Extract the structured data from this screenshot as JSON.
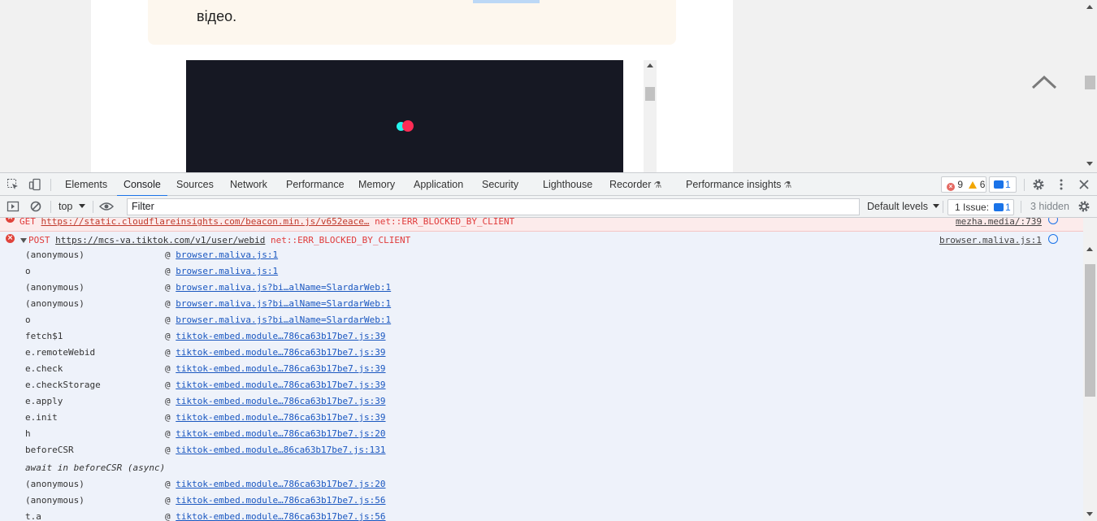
{
  "page": {
    "note_text": "відео.",
    "scroll_to_top_icon": "chevron-up-icon"
  },
  "devtools": {
    "tabs": [
      "Elements",
      "Console",
      "Sources",
      "Network",
      "Performance",
      "Memory",
      "Application",
      "Security",
      "Lighthouse",
      "Recorder",
      "Performance insights"
    ],
    "active_tab": "Console",
    "error_count": "9",
    "warning_count": "6",
    "message_count": "1",
    "toolbar": {
      "context": "top",
      "filter_placeholder": "Filter",
      "levels": "Default levels",
      "issues_label": "1 Issue:",
      "issues_count": "1",
      "hidden": "3 hidden"
    },
    "colors": {
      "accent": "#1a73e8",
      "error": "#e03a3a",
      "error_row_bg": "#fcebeb",
      "selected_row_bg": "#eef2fa"
    }
  },
  "console": {
    "get_row": {
      "method": "GET",
      "url": "https://static.cloudflareinsights.com/beacon.min.js/v652eace…",
      "error": "net::ERR_BLOCKED_BY_CLIENT",
      "source": "mezha.media/:739"
    },
    "post_row": {
      "method": "POST",
      "url": "https://mcs-va.tiktok.com/v1/user/webid",
      "error": "net::ERR_BLOCKED_BY_CLIENT",
      "source": "browser.maliva.js:1"
    },
    "stack": [
      {
        "fn": "(anonymous)",
        "link": "browser.maliva.js:1"
      },
      {
        "fn": "o",
        "link": "browser.maliva.js:1"
      },
      {
        "fn": "(anonymous)",
        "link": "browser.maliva.js?bi…alName=SlardarWeb:1"
      },
      {
        "fn": "(anonymous)",
        "link": "browser.maliva.js?bi…alName=SlardarWeb:1"
      },
      {
        "fn": "o",
        "link": "browser.maliva.js?bi…alName=SlardarWeb:1"
      },
      {
        "fn": "fetch$1",
        "link": "tiktok-embed.module…786ca63b17be7.js:39"
      },
      {
        "fn": "e.remoteWebid",
        "link": "tiktok-embed.module…786ca63b17be7.js:39"
      },
      {
        "fn": "e.check",
        "link": "tiktok-embed.module…786ca63b17be7.js:39"
      },
      {
        "fn": "e.checkStorage",
        "link": "tiktok-embed.module…786ca63b17be7.js:39"
      },
      {
        "fn": "e.apply",
        "link": "tiktok-embed.module…786ca63b17be7.js:39"
      },
      {
        "fn": "e.init",
        "link": "tiktok-embed.module…786ca63b17be7.js:39"
      },
      {
        "fn": "h",
        "link": "tiktok-embed.module…786ca63b17be7.js:20"
      },
      {
        "fn": "beforeCSR",
        "link": "tiktok-embed.module…86ca63b17be7.js:131"
      }
    ],
    "async_label": "await in beforeCSR (async)",
    "stack_after": [
      {
        "fn": "(anonymous)",
        "link": "tiktok-embed.module…786ca63b17be7.js:20"
      },
      {
        "fn": "(anonymous)",
        "link": "tiktok-embed.module…786ca63b17be7.js:56"
      },
      {
        "fn": "t.a",
        "link": "tiktok-embed.module…786ca63b17be7.js:56"
      }
    ]
  }
}
